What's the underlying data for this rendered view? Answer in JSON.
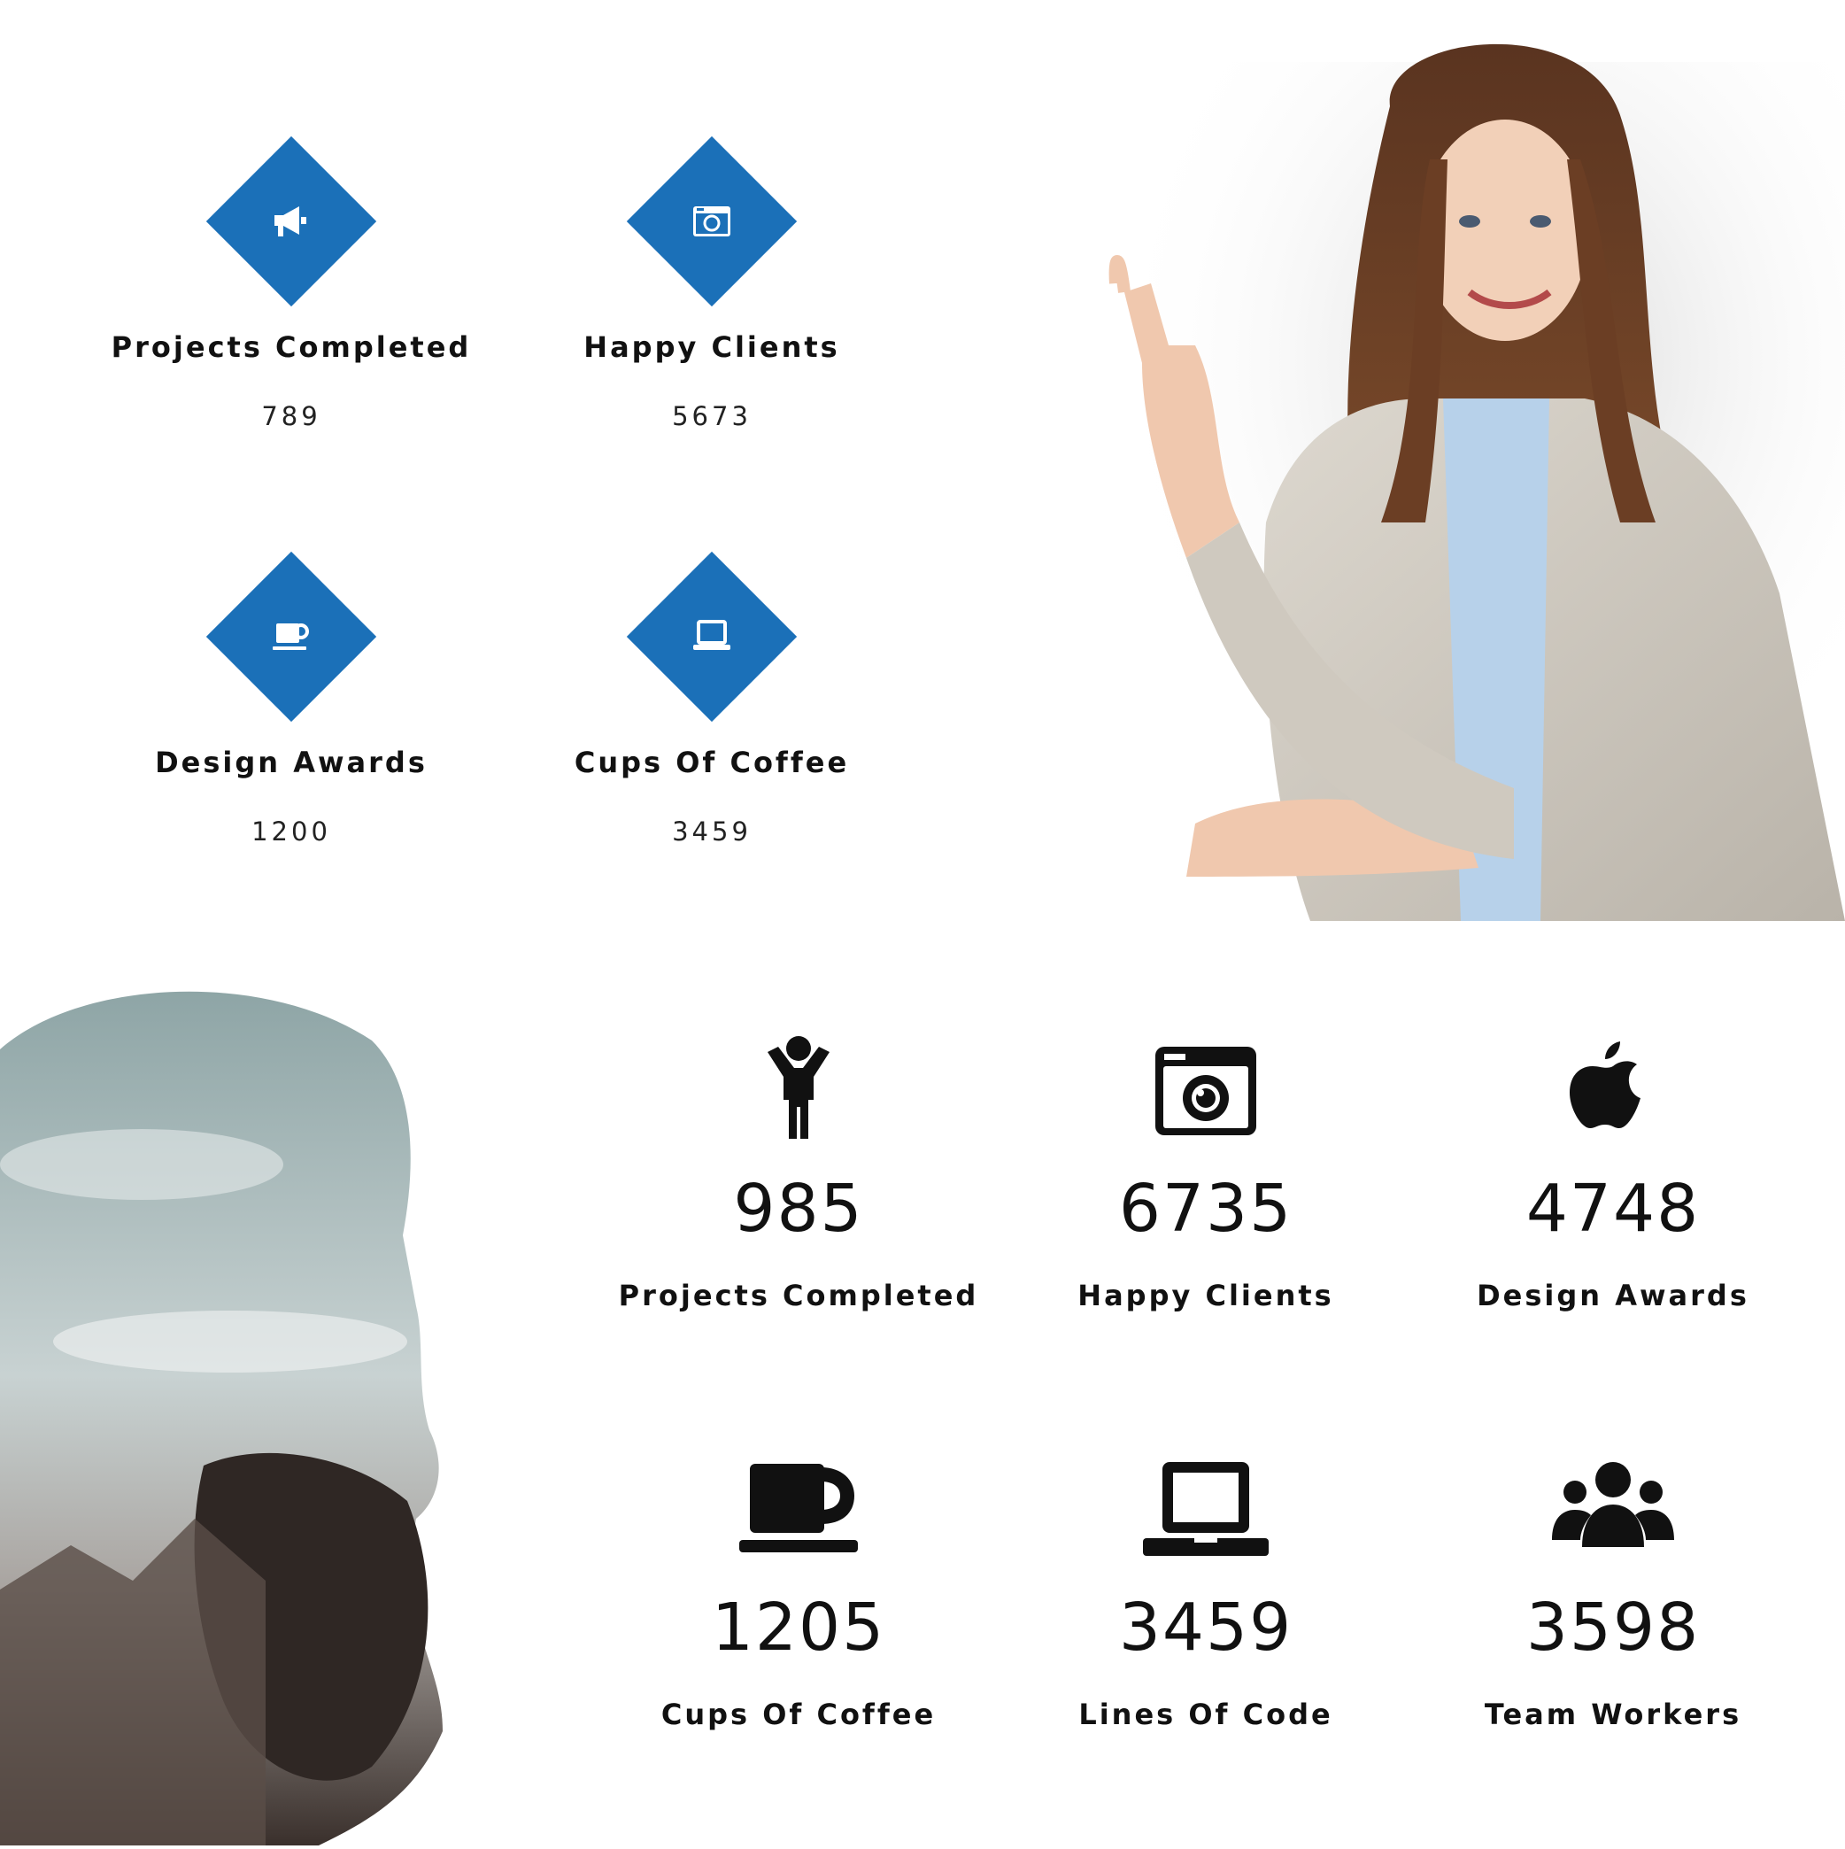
{
  "top_stats": [
    {
      "icon": "megaphone-icon",
      "label": "Projects Completed",
      "value": "789"
    },
    {
      "icon": "camera-icon",
      "label": "Happy Clients",
      "value": "5673"
    },
    {
      "icon": "coffee-cup-icon",
      "label": "Design Awards",
      "value": "1200"
    },
    {
      "icon": "laptop-icon",
      "label": "Cups Of Coffee",
      "value": "3459"
    }
  ],
  "bottom_stats": [
    {
      "icon": "child-icon",
      "value": "985",
      "label": "Projects Completed"
    },
    {
      "icon": "camera-icon",
      "value": "6735",
      "label": "Happy Clients"
    },
    {
      "icon": "apple-icon",
      "value": "4748",
      "label": "Design Awards"
    },
    {
      "icon": "coffee-cup-icon",
      "value": "1205",
      "label": "Cups Of Coffee"
    },
    {
      "icon": "laptop-icon",
      "value": "3459",
      "label": "Lines Of Code"
    },
    {
      "icon": "users-icon",
      "value": "3598",
      "label": "Team Workers"
    }
  ],
  "colors": {
    "accent": "#1b70b8",
    "text": "#111111",
    "background": "#ffffff"
  },
  "images": {
    "top_right": "businesswoman-pointing-photo",
    "bottom_left": "bearded-man-double-exposure-photo"
  }
}
